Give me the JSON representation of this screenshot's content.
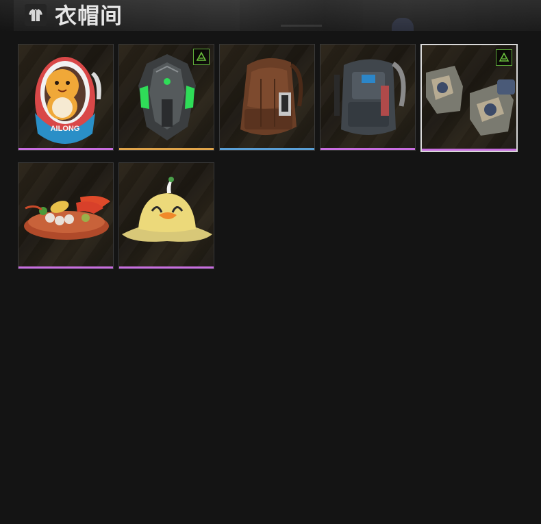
{
  "header": {
    "title": "衣帽间",
    "icon": "wardrobe-shirt-icon"
  },
  "items": [
    {
      "name": "egg-mascot-backpack",
      "art_text": "AILONG",
      "rarity_color": "#c86ee0",
      "selected": false,
      "badge": false
    },
    {
      "name": "armored-green-backpack",
      "rarity_color": "#e0a44a",
      "selected": false,
      "badge": true
    },
    {
      "name": "brown-tactical-backpack",
      "rarity_color": "#5a9fd6",
      "selected": false,
      "badge": false
    },
    {
      "name": "gray-tactical-backpack",
      "rarity_color": "#c86ee0",
      "selected": false,
      "badge": false
    },
    {
      "name": "camo-gloves",
      "rarity_color": "#c86ee0",
      "selected": true,
      "badge": true
    },
    {
      "name": "seafood-platter",
      "rarity_color": "#c86ee0",
      "selected": false,
      "badge": false
    },
    {
      "name": "duck-bucket-hat",
      "rarity_color": "#c86ee0",
      "selected": false,
      "badge": false
    }
  ],
  "badge_icon": "recycle-triangle-icon"
}
